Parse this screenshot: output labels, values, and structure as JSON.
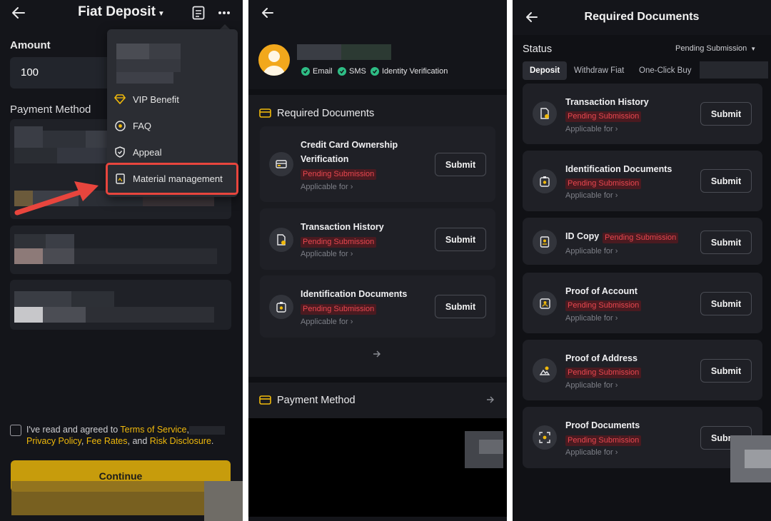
{
  "panel1": {
    "title": "Fiat Deposit",
    "amount_label": "Amount",
    "amount_value": "100",
    "payment_method_label": "Payment Method",
    "menu_items": [
      {
        "label": "VIP Benefit",
        "icon": "diamond-icon"
      },
      {
        "label": "FAQ",
        "icon": "question-icon"
      },
      {
        "label": "Appeal",
        "icon": "shield-icon"
      },
      {
        "label": "Material management",
        "icon": "document-icon"
      }
    ],
    "agreement": {
      "prefix": "I've read and agreed to ",
      "terms": "Terms of Service",
      "comma": ",",
      "privacy": "Privacy Policy",
      "sep": ", ",
      "fees": "Fee Rates",
      "and": ", and ",
      "risk": "Risk Disclosure",
      "end": "."
    },
    "continue_label": "Continue"
  },
  "panel2": {
    "verifications": [
      "Email",
      "SMS",
      "Identity Verification"
    ],
    "required_documents_title": "Required Documents",
    "documents": [
      {
        "title_line1": "Credit Card Ownership",
        "title_line2": "Verification",
        "status": "Pending Submission",
        "applicable": "Applicable for",
        "action": "Submit",
        "icon": "credit-card-icon"
      },
      {
        "title_line1": "Transaction History",
        "title_line2": "",
        "status": "Pending Submission",
        "applicable": "Applicable for",
        "action": "Submit",
        "icon": "transaction-history-icon"
      },
      {
        "title_line1": "Identification Documents",
        "title_line2": "",
        "status": "Pending Submission",
        "applicable": "Applicable for",
        "action": "Submit",
        "icon": "id-document-icon"
      }
    ],
    "payment_method_title": "Payment Method"
  },
  "panel3": {
    "title": "Required Documents",
    "status_label": "Status",
    "status_filter": "Pending Submission",
    "tabs": [
      "Deposit",
      "Withdraw Fiat",
      "One-Click Buy"
    ],
    "documents": [
      {
        "title": "Transaction History",
        "status": "Pending Submission",
        "applicable": "Applicable for",
        "action": "Submit",
        "icon": "transaction-history-icon"
      },
      {
        "title": "Identification Documents",
        "status": "Pending Submission",
        "applicable": "Applicable for",
        "action": "Submit",
        "icon": "id-document-icon"
      },
      {
        "title": "ID Copy",
        "status": "Pending Submission",
        "applicable": "Applicable for",
        "action": "Submit",
        "icon": "id-copy-icon"
      },
      {
        "title": "Proof of Account",
        "status": "Pending Submission",
        "applicable": "Applicable for",
        "action": "Submit",
        "icon": "account-icon"
      },
      {
        "title": "Proof of Address",
        "status": "Pending Submission",
        "applicable": "Applicable for",
        "action": "Submit",
        "icon": "address-icon"
      },
      {
        "title": "Proof Documents",
        "status": "Pending Submission",
        "applicable": "Applicable for",
        "action": "Subr",
        "icon": "proof-icon"
      }
    ]
  },
  "colors": {
    "background": "#14151a",
    "accent": "#f0b90b",
    "pending_text": "#e8474f",
    "pending_bg": "#4a1a20",
    "verified": "#2ebd85",
    "highlight": "#e8453d"
  }
}
